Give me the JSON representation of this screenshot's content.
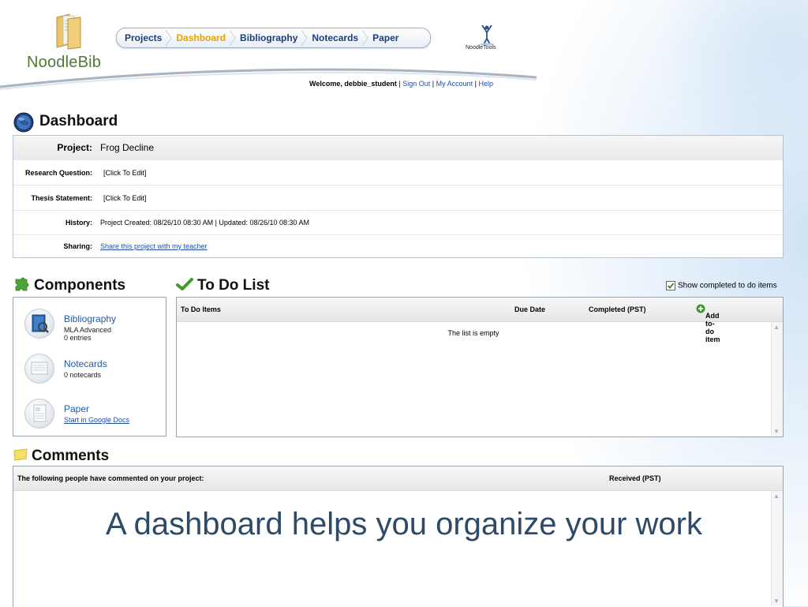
{
  "brand": {
    "name": "NoodleBib",
    "partner": "NoodleTools"
  },
  "nav": {
    "tabs": [
      {
        "label": "Projects",
        "active": false
      },
      {
        "label": "Dashboard",
        "active": true
      },
      {
        "label": "Bibliography",
        "active": false
      },
      {
        "label": "Notecards",
        "active": false
      },
      {
        "label": "Paper",
        "active": false
      }
    ]
  },
  "welcome": {
    "text": "Welcome, debbie_student",
    "sign_out": "Sign Out",
    "my_account": "My Account",
    "help": "Help"
  },
  "dashboard": {
    "title": "Dashboard",
    "rows": [
      {
        "label": "Project:",
        "value": "Frog Decline"
      },
      {
        "label": "Research Question:",
        "value": "[Click To Edit]"
      },
      {
        "label": "Thesis Statement:",
        "value": "[Click To Edit]"
      },
      {
        "label": "History:",
        "value": "Project Created: 08/26/10 08:30 AM | Updated: 08/26/10 08:30 AM"
      },
      {
        "label": "Sharing:",
        "value": "Share this project with my teacher"
      }
    ]
  },
  "components": {
    "title": "Components",
    "items": [
      {
        "title": "Bibliography",
        "line1": "MLA Advanced",
        "line2": "0 entries"
      },
      {
        "title": "Notecards",
        "line1": "0 notecards"
      },
      {
        "title": "Paper",
        "line1": "Start in Google Docs"
      }
    ]
  },
  "todo": {
    "title": "To Do List",
    "show_completed": "Show completed to do items",
    "show_completed_checked": true,
    "columns": [
      "To Do Items",
      "Due Date",
      "Completed (PST)"
    ],
    "add_label": "Add to-do item",
    "empty": "The list is empty"
  },
  "comments": {
    "title": "Comments",
    "columns": [
      "The following people have commented on your project:",
      "Received (PST)"
    ]
  },
  "caption": "A dashboard helps you organize your work",
  "colors": {
    "nav_text": "#1c3e7a",
    "nav_active": "#e7a200",
    "link": "#1f4fa0",
    "logo_green": "#4f7a35",
    "caption": "#2f4a66"
  }
}
